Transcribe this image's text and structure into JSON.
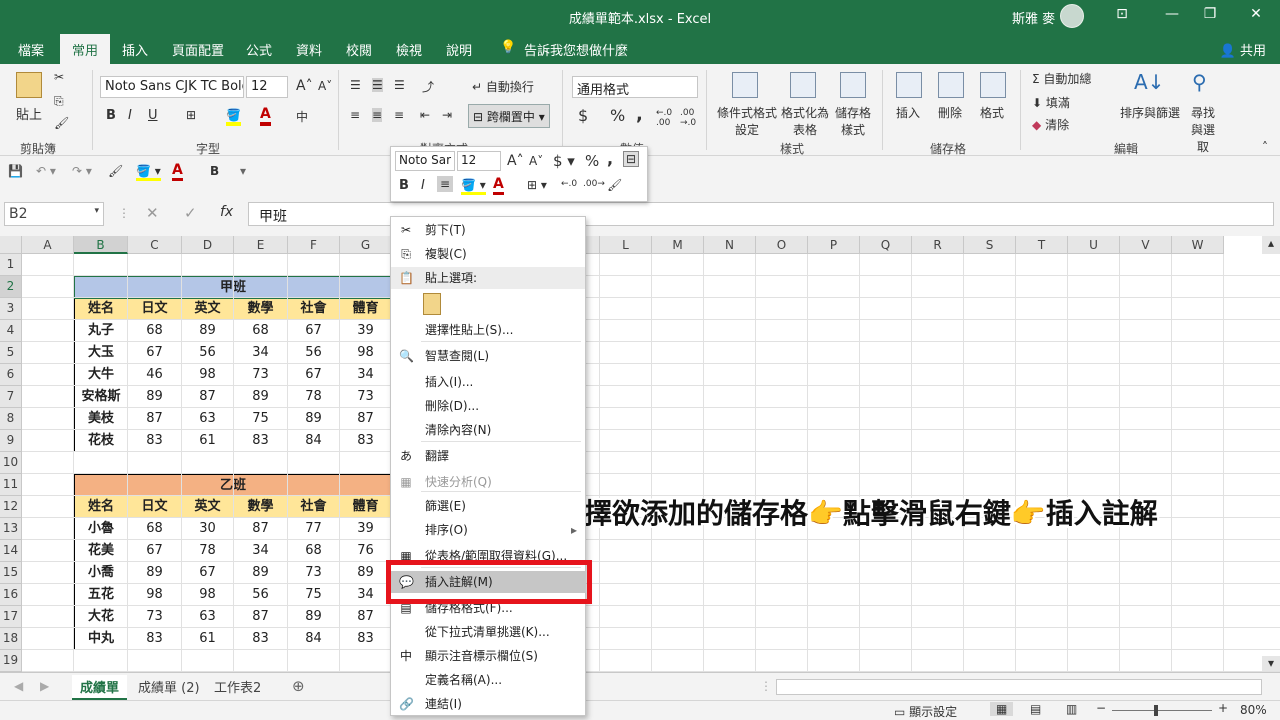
{
  "window": {
    "title": "成績單範本.xlsx  -  Excel",
    "user": "斯雅 麥",
    "minimize": "—",
    "restore": "❐",
    "close": "✕",
    "ribbon_toggle": "⊡"
  },
  "tabs": [
    "檔案",
    "常用",
    "插入",
    "頁面配置",
    "公式",
    "資料",
    "校閱",
    "檢視",
    "說明"
  ],
  "tell_me": "告訴我您想做什麼",
  "share": "共用",
  "ribbon": {
    "clipboard": {
      "paste": "貼上",
      "group": "剪貼簿"
    },
    "font": {
      "family": "Noto Sans CJK TC Bold",
      "size": "12",
      "group": "字型",
      "bold": "B",
      "italic": "I",
      "underline": "U"
    },
    "alignment": {
      "wrap": "自動換行",
      "merge": "跨欄置中",
      "group": "對齊方式"
    },
    "number": {
      "format": "通用格式",
      "group": "數值",
      "currency": "$",
      "percent": "%",
      "comma": ","
    },
    "styles": {
      "conditional": "條件式格式設定",
      "table": "格式化為表格",
      "cell_styles": "儲存格樣式",
      "group": "樣式"
    },
    "cells": {
      "insert": "插入",
      "delete": "刪除",
      "format": "格式",
      "group": "儲存格"
    },
    "editing": {
      "autosum": "自動加總",
      "fill": "填滿",
      "clear": "清除",
      "sort": "排序與篩選",
      "find": "尋找與選取",
      "group": "編輯"
    }
  },
  "namebox": "B2",
  "formula": "甲班",
  "fx": "fx",
  "columns": [
    "A",
    "B",
    "C",
    "D",
    "E",
    "F",
    "G",
    "H",
    "I",
    "J",
    "K",
    "L",
    "M",
    "N",
    "O",
    "P",
    "Q",
    "R",
    "S",
    "T",
    "U",
    "V",
    "W"
  ],
  "rows": [
    "1",
    "2",
    "3",
    "4",
    "5",
    "6",
    "7",
    "8",
    "9",
    "10",
    "11",
    "12",
    "13",
    "14",
    "15",
    "16",
    "17",
    "18",
    "19"
  ],
  "table1": {
    "title": "甲班",
    "headers": [
      "姓名",
      "日文",
      "英文",
      "數學",
      "社會",
      "體育"
    ],
    "rows": [
      [
        "丸子",
        "68",
        "89",
        "68",
        "67",
        "39"
      ],
      [
        "大玉",
        "67",
        "56",
        "34",
        "56",
        "98"
      ],
      [
        "大牛",
        "46",
        "98",
        "73",
        "67",
        "34"
      ],
      [
        "安格斯",
        "89",
        "87",
        "89",
        "78",
        "73"
      ],
      [
        "美枝",
        "87",
        "63",
        "75",
        "89",
        "87"
      ],
      [
        "花枝",
        "83",
        "61",
        "83",
        "84",
        "83"
      ]
    ]
  },
  "table2": {
    "title": "乙班",
    "headers": [
      "姓名",
      "日文",
      "英文",
      "數學",
      "社會",
      "體育"
    ],
    "rows": [
      [
        "小魯",
        "68",
        "30",
        "87",
        "77",
        "39"
      ],
      [
        "花美",
        "67",
        "78",
        "34",
        "68",
        "76"
      ],
      [
        "小喬",
        "89",
        "67",
        "89",
        "73",
        "89"
      ],
      [
        "五花",
        "98",
        "98",
        "56",
        "75",
        "34"
      ],
      [
        "大花",
        "73",
        "63",
        "87",
        "89",
        "87"
      ],
      [
        "中丸",
        "83",
        "61",
        "83",
        "84",
        "83"
      ]
    ]
  },
  "minibar": {
    "font": "Noto Sar",
    "size": "12"
  },
  "context_menu": [
    {
      "label": "剪下(T)",
      "icon": "✂",
      "disabled": false
    },
    {
      "label": "複製(C)",
      "icon": "⎘",
      "disabled": false
    },
    {
      "label": "貼上選項:",
      "icon": "📋",
      "disabled": false
    },
    {
      "label": "選擇性貼上(S)...",
      "icon": "",
      "disabled": false
    },
    {
      "label": "智慧查閱(L)",
      "icon": "🔍",
      "disabled": false
    },
    {
      "label": "插入(I)...",
      "icon": "",
      "disabled": false
    },
    {
      "label": "刪除(D)...",
      "icon": "",
      "disabled": false
    },
    {
      "label": "清除內容(N)",
      "icon": "",
      "disabled": false
    },
    {
      "label": "翻譯",
      "icon": "あ",
      "disabled": false
    },
    {
      "label": "快速分析(Q)",
      "icon": "▦",
      "disabled": true
    },
    {
      "label": "篩選(E)",
      "icon": "",
      "disabled": false
    },
    {
      "label": "排序(O)",
      "icon": "",
      "disabled": false
    },
    {
      "label": "從表格/範圍取得資料(G)...",
      "icon": "▦",
      "disabled": false
    },
    {
      "label": "插入註解(M)",
      "icon": "💬",
      "disabled": false
    },
    {
      "label": "儲存格格式(F)...",
      "icon": "▤",
      "disabled": false
    },
    {
      "label": "從下拉式清單挑選(K)...",
      "icon": "",
      "disabled": false
    },
    {
      "label": "顯示注音標示欄位(S)",
      "icon": "中",
      "disabled": false
    },
    {
      "label": "定義名稱(A)...",
      "icon": "",
      "disabled": false
    },
    {
      "label": "連結(I)",
      "icon": "🔗",
      "disabled": false
    }
  ],
  "sheets": [
    "成績單",
    "成績單 (2)",
    "工作表2"
  ],
  "status": {
    "display_settings": "顯示設定",
    "zoom": "80%"
  },
  "caption": "選擇欲添加的儲存格👉點擊滑鼠右鍵👉插入註解",
  "colors": {
    "brand": "#217346",
    "header_blue": "#b4c6e7",
    "header_orange": "#f4b183",
    "header_yellow": "#ffe699",
    "highlight_red": "#e6141c"
  }
}
